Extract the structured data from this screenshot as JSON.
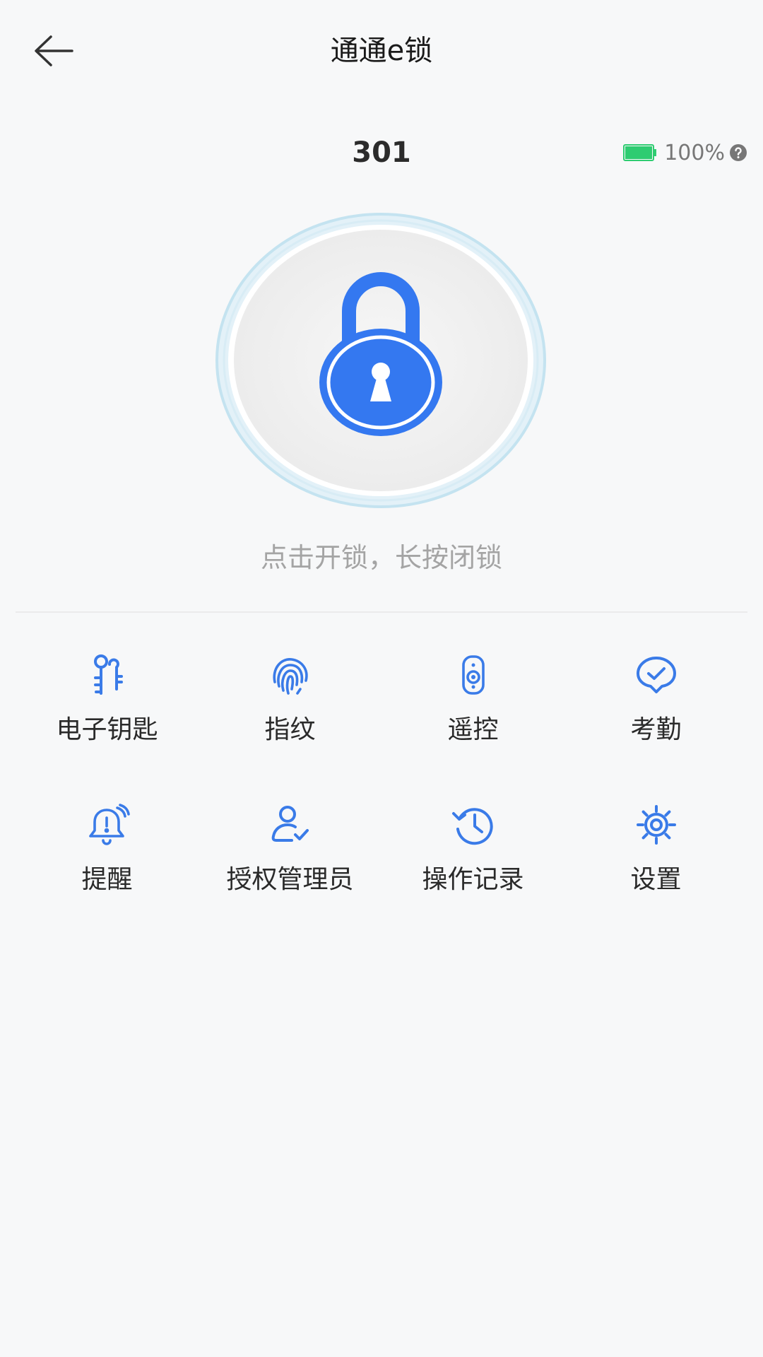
{
  "header": {
    "title": "通通e锁",
    "back_icon": "arrow-left-icon"
  },
  "device": {
    "name": "301",
    "battery_level": "100%",
    "battery_fraction": 1.0,
    "battery_color": "#2ecc71"
  },
  "lock": {
    "icon": "padlock-icon",
    "accent_color": "#3478f0",
    "hint": "点击开锁，长按闭锁"
  },
  "menu": {
    "items": [
      {
        "label": "电子钥匙",
        "icon": "key-icon"
      },
      {
        "label": "指纹",
        "icon": "fingerprint-icon"
      },
      {
        "label": "遥控",
        "icon": "remote-control-icon"
      },
      {
        "label": "考勤",
        "icon": "attendance-check-icon"
      },
      {
        "label": "提醒",
        "icon": "bell-alert-icon"
      },
      {
        "label": "授权管理员",
        "icon": "user-check-icon"
      },
      {
        "label": "操作记录",
        "icon": "history-icon"
      },
      {
        "label": "设置",
        "icon": "gear-icon"
      }
    ]
  }
}
